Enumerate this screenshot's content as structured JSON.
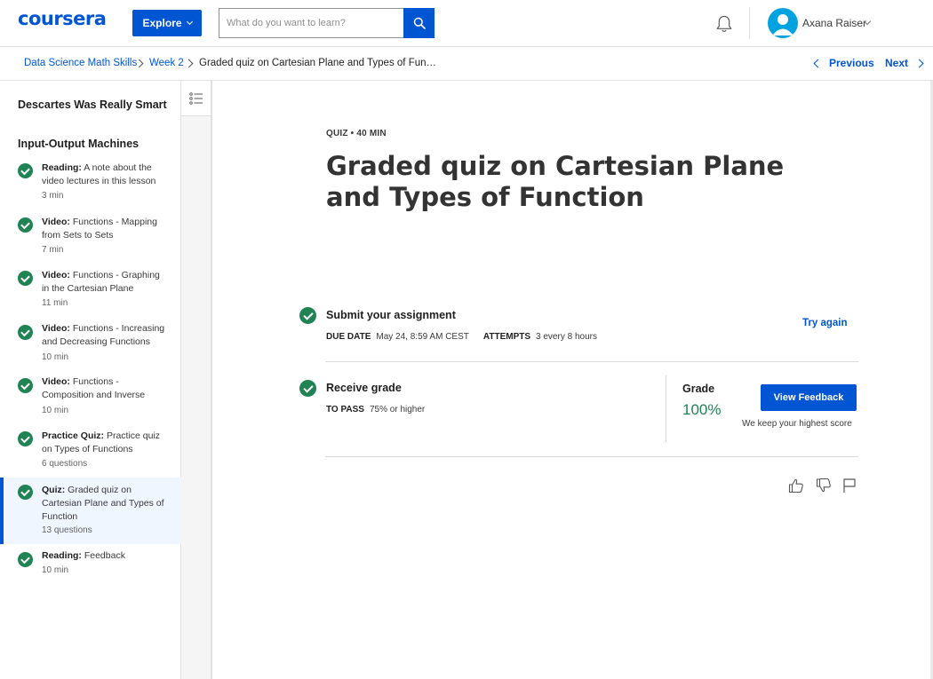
{
  "header": {
    "logo": "coursera",
    "explore_label": "Explore",
    "search_placeholder": "What do you want to learn?",
    "user_name": "Axana Raiser"
  },
  "breadcrumb": {
    "items": [
      "Data Science Math Skills",
      "Week 2",
      "Graded quiz on Cartesian Plane and Types of Fun…"
    ],
    "previous_label": "Previous",
    "next_label": "Next"
  },
  "sidebar": {
    "module_titles": [
      "Descartes Was Really Smart",
      "Input-Output Machines"
    ],
    "items": [
      {
        "type": "Reading:",
        "title": "A note about the video lectures in this lesson",
        "meta": "3 min",
        "completed": true
      },
      {
        "type": "Video:",
        "title": "Functions - Mapping from Sets to Sets",
        "meta": "7 min",
        "completed": true
      },
      {
        "type": "Video:",
        "title": "Functions - Graphing in the Cartesian Plane",
        "meta": "11 min",
        "completed": true
      },
      {
        "type": "Video:",
        "title": "Functions - Increasing and Decreasing Functions",
        "meta": "10 min",
        "completed": true
      },
      {
        "type": "Video:",
        "title": "Functions - Composition and Inverse",
        "meta": "10 min",
        "completed": true
      },
      {
        "type": "Practice Quiz:",
        "title": "Practice quiz on Types of Functions",
        "meta": "6 questions",
        "completed": true
      },
      {
        "type": "Quiz:",
        "title": "Graded quiz on Cartesian Plane and Types of Function",
        "meta": "13 questions",
        "completed": true,
        "active": true
      },
      {
        "type": "Reading:",
        "title": "Feedback",
        "meta": "10 min",
        "completed": true
      }
    ]
  },
  "main": {
    "kicker": "QUIZ • 40 MIN",
    "title": "Graded quiz on Cartesian Plane and Types of Function",
    "submit": {
      "title": "Submit your assignment",
      "due_label": "DUE DATE",
      "due_value": "May 24, 8:59 AM CEST",
      "attempts_label": "ATTEMPTS",
      "attempts_value": "3 every 8 hours",
      "try_again": "Try again"
    },
    "grade": {
      "title": "Receive grade",
      "pass_label": "TO PASS",
      "pass_value": "75% or higher",
      "grade_label": "Grade",
      "grade_value": "100%",
      "feedback_button": "View Feedback",
      "note": "We keep your highest score"
    }
  },
  "colors": {
    "brand": "#0056d2",
    "success": "#1f8354"
  }
}
